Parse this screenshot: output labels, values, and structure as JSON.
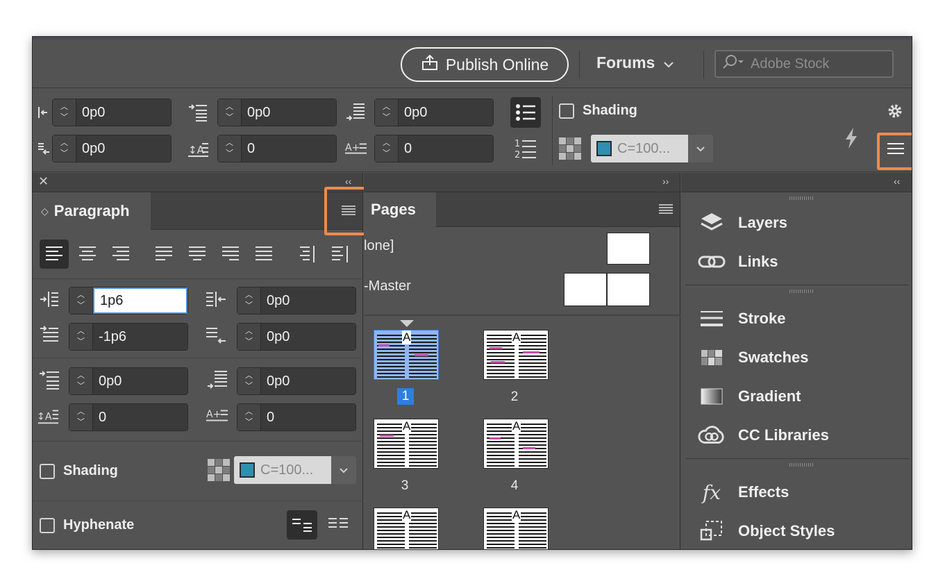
{
  "appbar": {
    "publish_label": "Publish Online",
    "forums_label": "Forums",
    "stock_placeholder": "Adobe Stock"
  },
  "control_strip": {
    "left_indent": "0p0",
    "last_line_indent": "0p0",
    "space_before": "0p0",
    "drop_cap_lines": "0",
    "space_after": "0p0",
    "drop_cap_chars": "0",
    "shading_label": "Shading",
    "shading_swatch": "C=100..."
  },
  "paragraph_panel": {
    "title": "Paragraph",
    "left_indent": "1p6",
    "right_indent": "0p0",
    "first_line_indent": "-1p6",
    "last_line_indent": "0p0",
    "space_before": "0p0",
    "space_after": "0p0",
    "drop_cap_lines": "0",
    "drop_cap_chars": "0",
    "shading_label": "Shading",
    "shading_swatch": "C=100...",
    "hyphenate_label": "Hyphenate"
  },
  "pages_panel": {
    "title": "Pages",
    "master_none": "lone]",
    "master_a": "-Master",
    "pages": [
      "1",
      "2",
      "3",
      "4"
    ],
    "selected_page": "1"
  },
  "dock": {
    "group1": [
      "Layers",
      "Links"
    ],
    "group2": [
      "Stroke",
      "Swatches",
      "Gradient",
      "CC Libraries"
    ],
    "group3": [
      "Effects",
      "Object Styles"
    ]
  },
  "colors": {
    "highlight": "#ef8a4b",
    "panel_bg": "#535353",
    "selected_blue": "#2f7de0",
    "swatch_chip": "#2e8fb0"
  }
}
